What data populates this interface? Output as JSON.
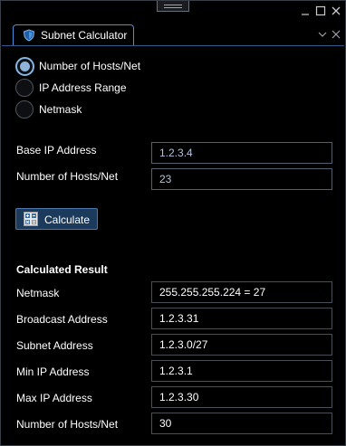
{
  "window": {
    "tab_title": "Subnet Calculator"
  },
  "mode_options": [
    {
      "label": "Number of Hosts/Net",
      "checked": true
    },
    {
      "label": "IP Address Range",
      "checked": false
    },
    {
      "label": "Netmask",
      "checked": false
    }
  ],
  "inputs": {
    "base_ip_label": "Base IP Address",
    "base_ip_value": "1.2.3.4",
    "hosts_label": "Number of Hosts/Net",
    "hosts_value": "23"
  },
  "calculate_button": {
    "label": "Calculate"
  },
  "result": {
    "title": "Calculated Result",
    "rows": [
      {
        "label": "Netmask",
        "value": "255.255.255.224 = 27"
      },
      {
        "label": "Broadcast Address",
        "value": "1.2.3.31"
      },
      {
        "label": "Subnet Address",
        "value": "1.2.3.0/27"
      },
      {
        "label": "Min IP Address",
        "value": "1.2.3.1"
      },
      {
        "label": "Max IP Address",
        "value": "1.2.3.30"
      },
      {
        "label": "Number of Hosts/Net",
        "value": "30"
      }
    ]
  },
  "icons": {
    "tab": "shield-icon",
    "calculate": "calculator-icon",
    "minimize": "minimize-icon",
    "maximize": "maximize-icon",
    "close": "close-icon",
    "tab_dropdown": "chevron-down-icon",
    "tab_close": "close-icon"
  },
  "colors": {
    "accent": "#4a90d9",
    "background": "#000000",
    "button_bg": "#1b3a5c"
  }
}
